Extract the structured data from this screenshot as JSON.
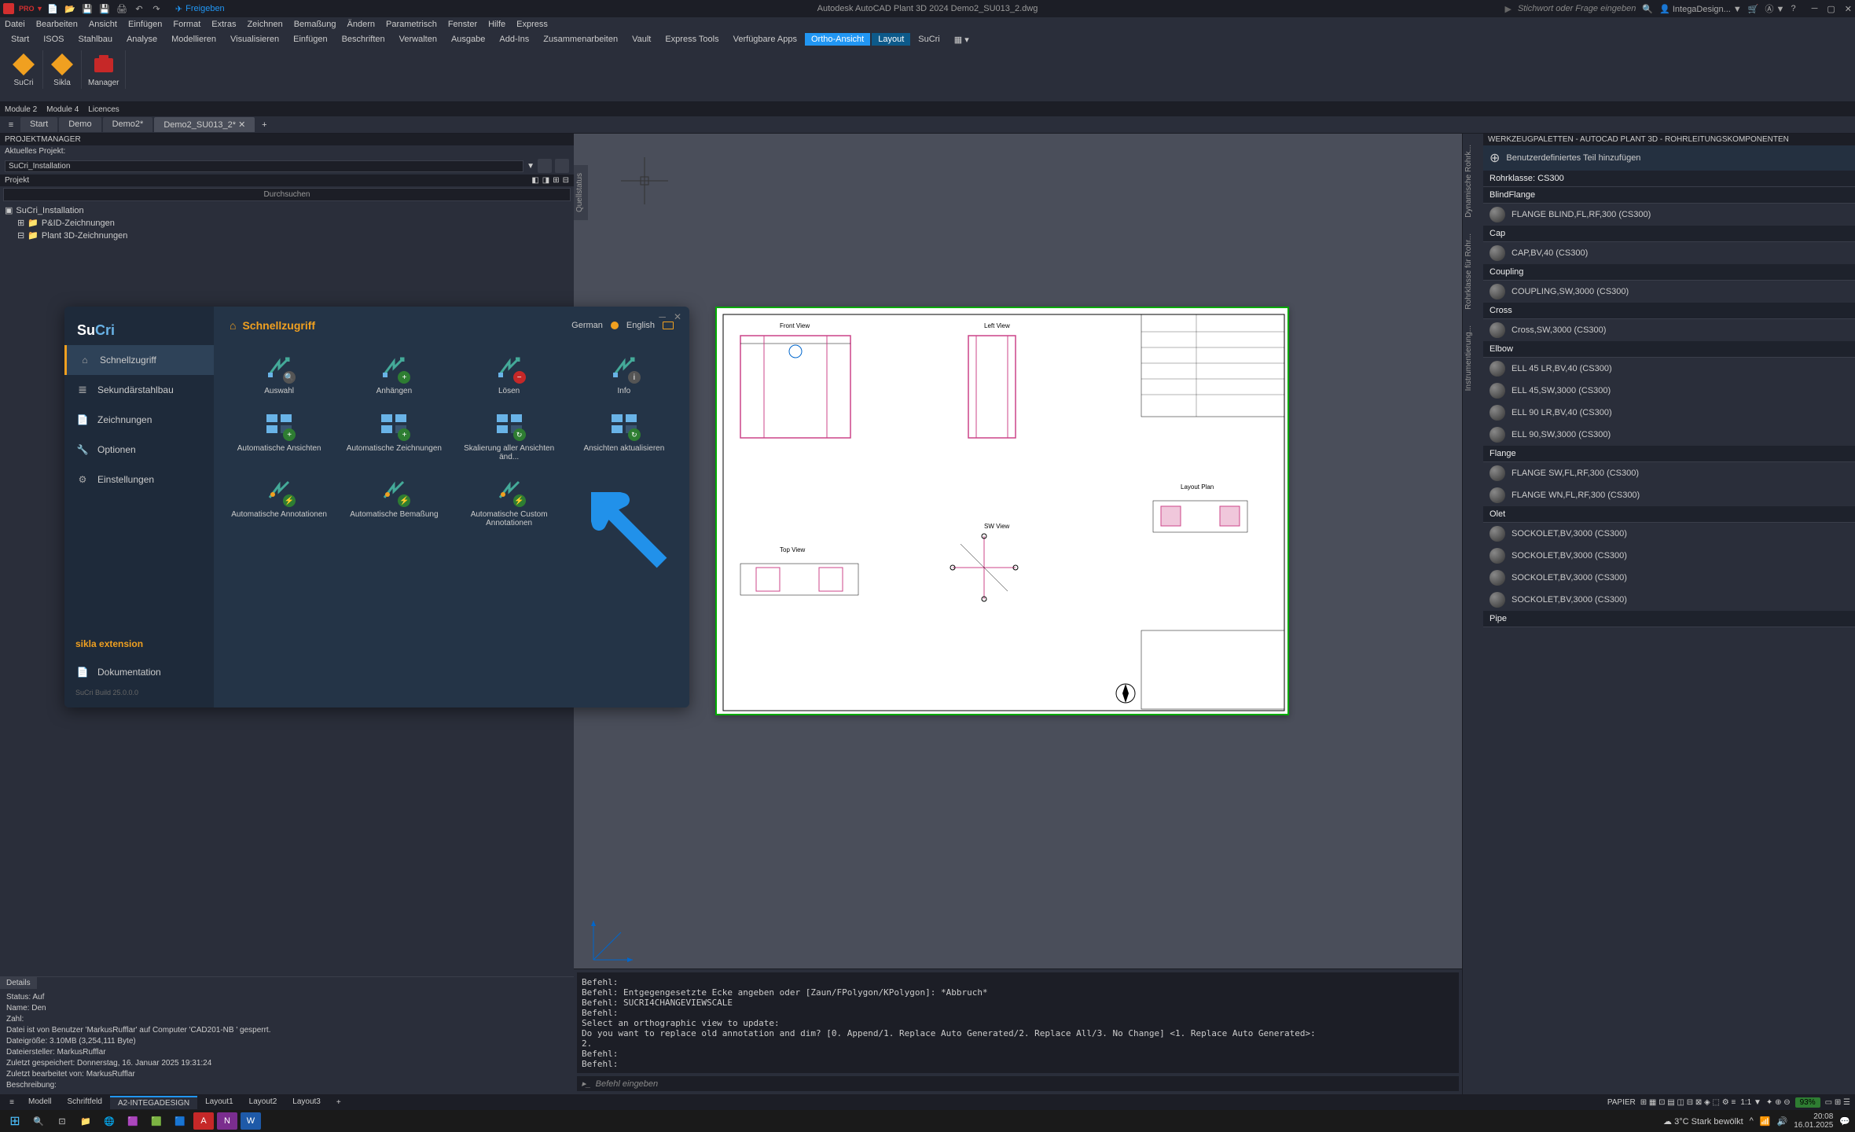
{
  "titlebar": {
    "share": "Freigeben",
    "center": "Autodesk AutoCAD Plant 3D 2024   Demo2_SU013_2.dwg",
    "search_placeholder": "Stichwort oder Frage eingeben",
    "user": "IntegaDesign..."
  },
  "menubar": [
    "Datei",
    "Bearbeiten",
    "Ansicht",
    "Einfügen",
    "Format",
    "Extras",
    "Zeichnen",
    "Bemaßung",
    "Ändern",
    "Parametrisch",
    "Fenster",
    "Hilfe",
    "Express"
  ],
  "ribbontabs": [
    "Start",
    "ISOS",
    "Stahlbau",
    "Analyse",
    "Modellieren",
    "Visualisieren",
    "Einfügen",
    "Beschriften",
    "Verwalten",
    "Ausgabe",
    "Add-Ins",
    "Zusammenarbeiten",
    "Vault",
    "Express Tools",
    "Verfügbare Apps",
    "Ortho-Ansicht",
    "Layout",
    "SuCri"
  ],
  "active_ribbon_tab": "Ortho-Ansicht",
  "active_ribbon_tab2": "Layout",
  "ribbon_groups": [
    {
      "icon": "diamond-orange",
      "label": "SuCri"
    },
    {
      "icon": "diamond-orange",
      "label": "Sikla"
    },
    {
      "icon": "folder-red",
      "label": "Manager"
    }
  ],
  "subbar": [
    "Module 2",
    "Module 4",
    "Licences"
  ],
  "doctabs": {
    "items": [
      "Start",
      "Demo",
      "Demo2*",
      "Demo2_SU013_2*"
    ],
    "active": "Demo2_SU013_2*"
  },
  "projectmanager": {
    "title": "PROJEKTMANAGER",
    "current_label": "Aktuelles Projekt:",
    "project_name": "SuCri_Installation",
    "section": "Projekt",
    "search": "Durchsuchen",
    "tree": [
      "SuCri_Installation",
      "P&ID-Zeichnungen",
      "Plant 3D-Zeichnungen"
    ]
  },
  "details": {
    "tab": "Details",
    "lines": [
      "Status: Auf",
      "Name: Den",
      "Zahl:",
      "Datei ist von Benutzer 'MarkusRufflar' auf Computer 'CAD201-NB ' gesperrt.",
      "Dateigröße: 3.10MB (3,254,111 Byte)",
      "Dateiersteller:  MarkusRufflar",
      "Zuletzt gespeichert: Donnerstag, 16. Januar 2025 19:31:24",
      "Zuletzt bearbeitet von: MarkusRufflar",
      "Beschreibung:"
    ]
  },
  "sucri": {
    "title": "Schnellzugriff",
    "lang_de": "German",
    "lang_en": "English",
    "nav": [
      {
        "icon": "home",
        "label": "Schnellzugriff"
      },
      {
        "icon": "beam",
        "label": "Sekundärstahlbau"
      },
      {
        "icon": "doc",
        "label": "Zeichnungen"
      },
      {
        "icon": "wrench",
        "label": "Optionen"
      },
      {
        "icon": "gear",
        "label": "Einstellungen"
      }
    ],
    "extension": "sikla extension",
    "doc_nav": {
      "icon": "file",
      "label": "Dokumentation"
    },
    "build": "SuCri Build 25.0.0.0",
    "cells": [
      {
        "label": "Auswahl",
        "badge": "search"
      },
      {
        "label": "Anhängen",
        "badge": "plus"
      },
      {
        "label": "Lösen",
        "badge": "minus"
      },
      {
        "label": "Info",
        "badge": "info"
      },
      {
        "label": "Automatische Ansichten",
        "badge": "plus"
      },
      {
        "label": "Automatische Zeichnungen",
        "badge": "plus"
      },
      {
        "label": "Skalierung aller Ansichten änd...",
        "badge": "refresh"
      },
      {
        "label": "Ansichten aktualisieren",
        "badge": "refresh"
      },
      {
        "label": "Automatische Annotationen",
        "badge": "bolt"
      },
      {
        "label": "Automatische Bemaßung",
        "badge": "bolt"
      },
      {
        "label": "Automatische Custom Annotationen",
        "badge": "bolt"
      }
    ]
  },
  "viewport": {
    "side_tab": "Quellstatus",
    "sheet_views": [
      "Front View",
      "Left View",
      "Top View",
      "SW View",
      "Layout Plan"
    ]
  },
  "cmdline": {
    "lines": [
      "Befehl:",
      "Befehl: Entgegengesetzte Ecke angeben oder [Zaun/FPolygon/KPolygon]: *Abbruch*",
      "Befehl: SUCRI4CHANGEVIEWSCALE",
      "Befehl:",
      "Select an orthographic view to update:",
      "Do you want to replace old annotation and dim? [0. Append/1. Replace Auto Generated/2. Replace All/3. No Change] <1. Replace Auto Generated>:",
      "2.",
      "Befehl:",
      "Befehl:"
    ],
    "prompt": "Befehl eingeben"
  },
  "palette": {
    "title": "WERKZEUGPALETTEN - AUTOCAD PLANT 3D - ROHRLEITUNGSKOMPONENTEN",
    "tabs": [
      "Dynamische Rohrk...",
      "Rohrklasse für Rohr...",
      "Instrumentierung..."
    ],
    "user_add": "Benutzerdefiniertes Teil hinzufügen",
    "pipeclass": "Rohrklasse: CS300",
    "groups": [
      {
        "name": "BlindFlange",
        "items": [
          "FLANGE BLIND,FL,RF,300 (CS300)"
        ]
      },
      {
        "name": "Cap",
        "items": [
          "CAP,BV,40 (CS300)"
        ]
      },
      {
        "name": "Coupling",
        "items": [
          "COUPLING,SW,3000 (CS300)"
        ]
      },
      {
        "name": "Cross",
        "items": [
          "Cross,SW,3000 (CS300)"
        ]
      },
      {
        "name": "Elbow",
        "items": [
          "ELL 45 LR,BV,40 (CS300)",
          "ELL 45,SW,3000 (CS300)",
          "ELL 90 LR,BV,40 (CS300)",
          "ELL 90,SW,3000 (CS300)"
        ]
      },
      {
        "name": "Flange",
        "items": [
          "FLANGE SW,FL,RF,300 (CS300)",
          "FLANGE WN,FL,RF,300 (CS300)"
        ]
      },
      {
        "name": "Olet",
        "items": [
          "SOCKOLET,BV,3000 (CS300)",
          "SOCKOLET,BV,3000 (CS300)",
          "SOCKOLET,BV,3000 (CS300)",
          "SOCKOLET,BV,3000 (CS300)"
        ]
      },
      {
        "name": "Pipe",
        "items": []
      }
    ]
  },
  "layouttabs": {
    "items": [
      "Modell",
      "Schriftfeld",
      "A2-INTEGADESIGN",
      "Layout1",
      "Layout2",
      "Layout3"
    ],
    "active": "A2-INTEGADESIGN",
    "paper_label": "PAPIER",
    "gauge": "93%"
  },
  "taskbar": {
    "weather": "3°C Stark bewölkt",
    "time": "20:08",
    "date": "16.01.2025"
  }
}
